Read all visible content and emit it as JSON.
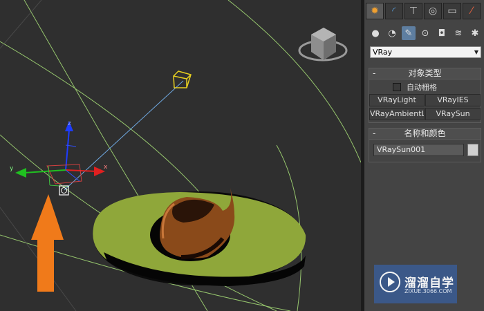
{
  "command_panel": {
    "tabs": [
      {
        "icon": "create-sun-icon",
        "active": true
      },
      {
        "icon": "modify-icon",
        "active": false
      },
      {
        "icon": "hierarchy-icon",
        "active": false
      },
      {
        "icon": "motion-icon",
        "active": false
      },
      {
        "icon": "display-icon",
        "active": false
      },
      {
        "icon": "utilities-icon",
        "active": false
      }
    ],
    "sub_icons": [
      "geometry-icon",
      "shapes-icon",
      "lights-icon",
      "cameras-icon",
      "helpers-icon",
      "spacewarps-icon",
      "systems-icon"
    ],
    "active_sub_icon": "lights-icon",
    "category_dropdown": {
      "value": "VRay"
    },
    "object_type": {
      "title": "对象类型",
      "collapse": "-",
      "autogrid_label": "自动栅格",
      "buttons": [
        "VRayLight",
        "VRayIES",
        "VRayAmbientLight",
        "VRaySun"
      ]
    },
    "name_color": {
      "title": "名称和颜色",
      "collapse": "-",
      "name_value": "VRaySun001",
      "color": "#cfcfcf"
    }
  },
  "viewport": {
    "axis_labels": {
      "x": "x",
      "y": "y",
      "z": "z"
    },
    "colors": {
      "plate": "#8fa73a",
      "teapot": "#8a4a1a",
      "arrow": "#f07a1a",
      "sun": "#e8d020",
      "grid": "#a8e078"
    }
  },
  "watermark": {
    "title": "溜溜自学",
    "url": "ZIXUE.3066.COM"
  }
}
